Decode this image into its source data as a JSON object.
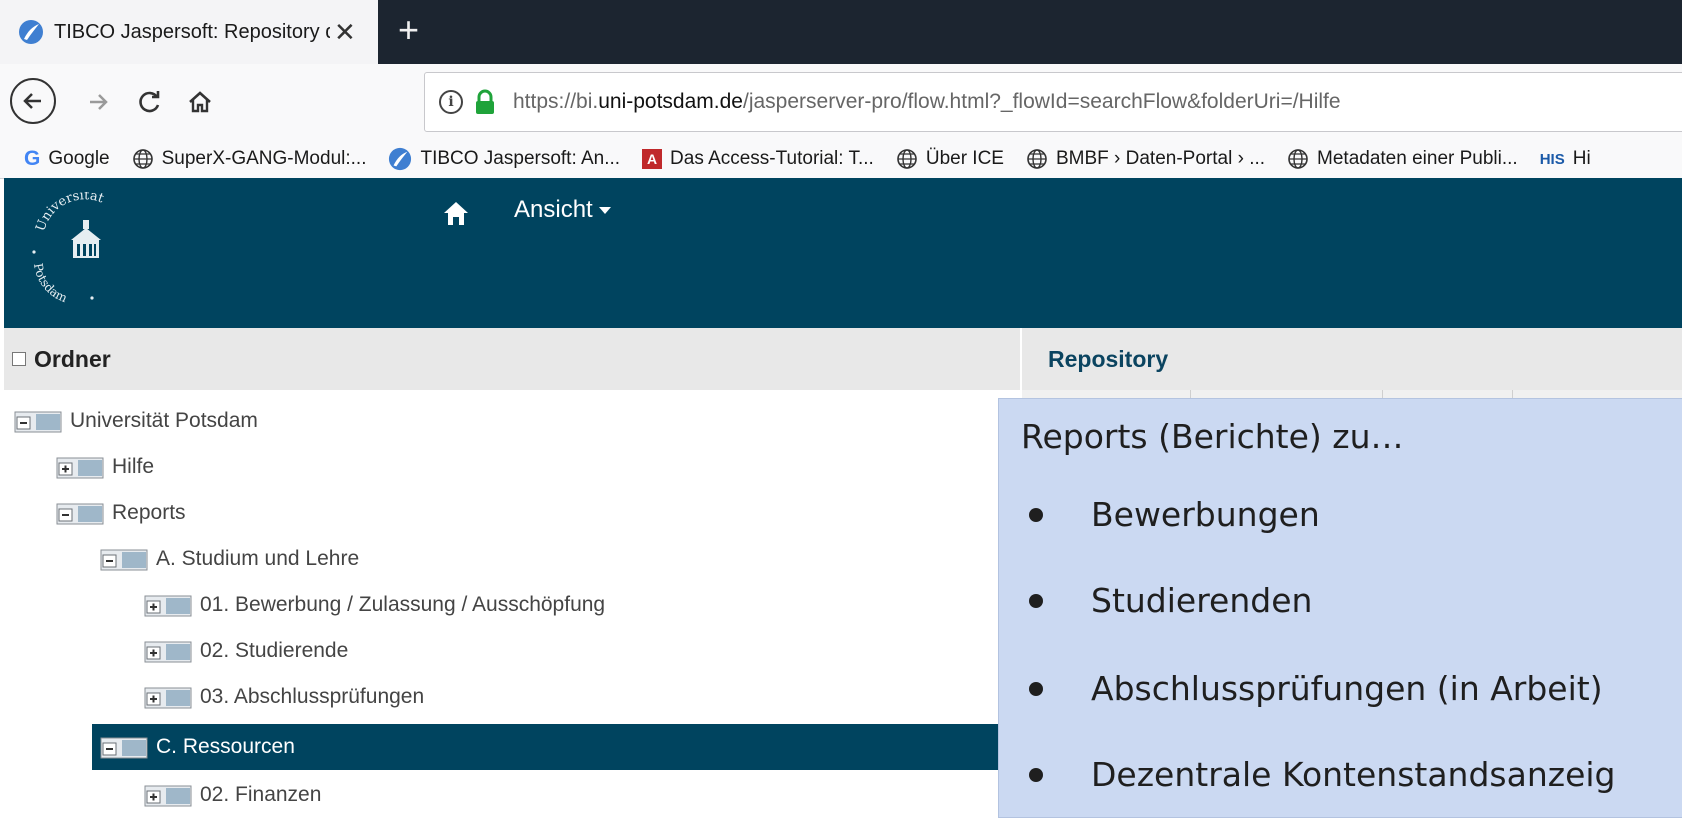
{
  "browser": {
    "tab_title": "TIBCO Jaspersoft: Repository du",
    "new_tab_label": "+",
    "close_label": "✕",
    "url_prefix": "https://bi.",
    "url_domain": "uni-potsdam.de",
    "url_path": "/jasperserver-pro/flow.html?_flowId=searchFlow&folderUri=/Hilfe"
  },
  "bookmarks": [
    {
      "label": "Google",
      "icon": "google-icon"
    },
    {
      "label": "SuperX-GANG-Modul:...",
      "icon": "globe-icon"
    },
    {
      "label": "TIBCO Jaspersoft: An...",
      "icon": "jaspersoft-icon"
    },
    {
      "label": "Das Access-Tutorial: T...",
      "icon": "access-icon"
    },
    {
      "label": "Über ICE",
      "icon": "globe-icon"
    },
    {
      "label": "BMBF › Daten-Portal › ...",
      "icon": "globe-icon"
    },
    {
      "label": "Metadaten einer Publi...",
      "icon": "globe-icon"
    },
    {
      "label": "Hi",
      "icon": "his-icon"
    }
  ],
  "header": {
    "menu_label": "Ansicht",
    "logo_text_top": "Universität",
    "logo_text_bottom": "Potsdam"
  },
  "panels": {
    "left_title": "Ordner",
    "right_title": "Repository"
  },
  "tree": [
    {
      "label": "Universität Potsdam",
      "state": "expanded",
      "level": 0,
      "selected": false
    },
    {
      "label": "Hilfe",
      "state": "collapsed",
      "level": 1,
      "selected": false
    },
    {
      "label": "Reports",
      "state": "expanded",
      "level": 1,
      "selected": false
    },
    {
      "label": "A. Studium und Lehre",
      "state": "expanded",
      "level": 2,
      "selected": false
    },
    {
      "label": "01. Bewerbung / Zulassung / Ausschöpfung",
      "state": "collapsed",
      "level": 3,
      "selected": false
    },
    {
      "label": "02. Studierende",
      "state": "collapsed",
      "level": 3,
      "selected": false
    },
    {
      "label": "03. Abschlussprüfungen",
      "state": "collapsed",
      "level": 3,
      "selected": false
    },
    {
      "label": "C. Ressourcen",
      "state": "expanded",
      "level": 2,
      "selected": true
    },
    {
      "label": "02. Finanzen",
      "state": "collapsed",
      "level": 3,
      "selected": false
    }
  ],
  "overlay": {
    "heading": "Reports (Berichte) zu…",
    "items": [
      "Bewerbungen",
      "Studierenden",
      "Abschlussprüfungen (in Arbeit)",
      "Dezentrale Kontenstandsanzeig"
    ]
  },
  "colors": {
    "header_bg": "#00445f",
    "overlay_bg": "#cbd9f2",
    "accent_green": "#1fa33a"
  }
}
